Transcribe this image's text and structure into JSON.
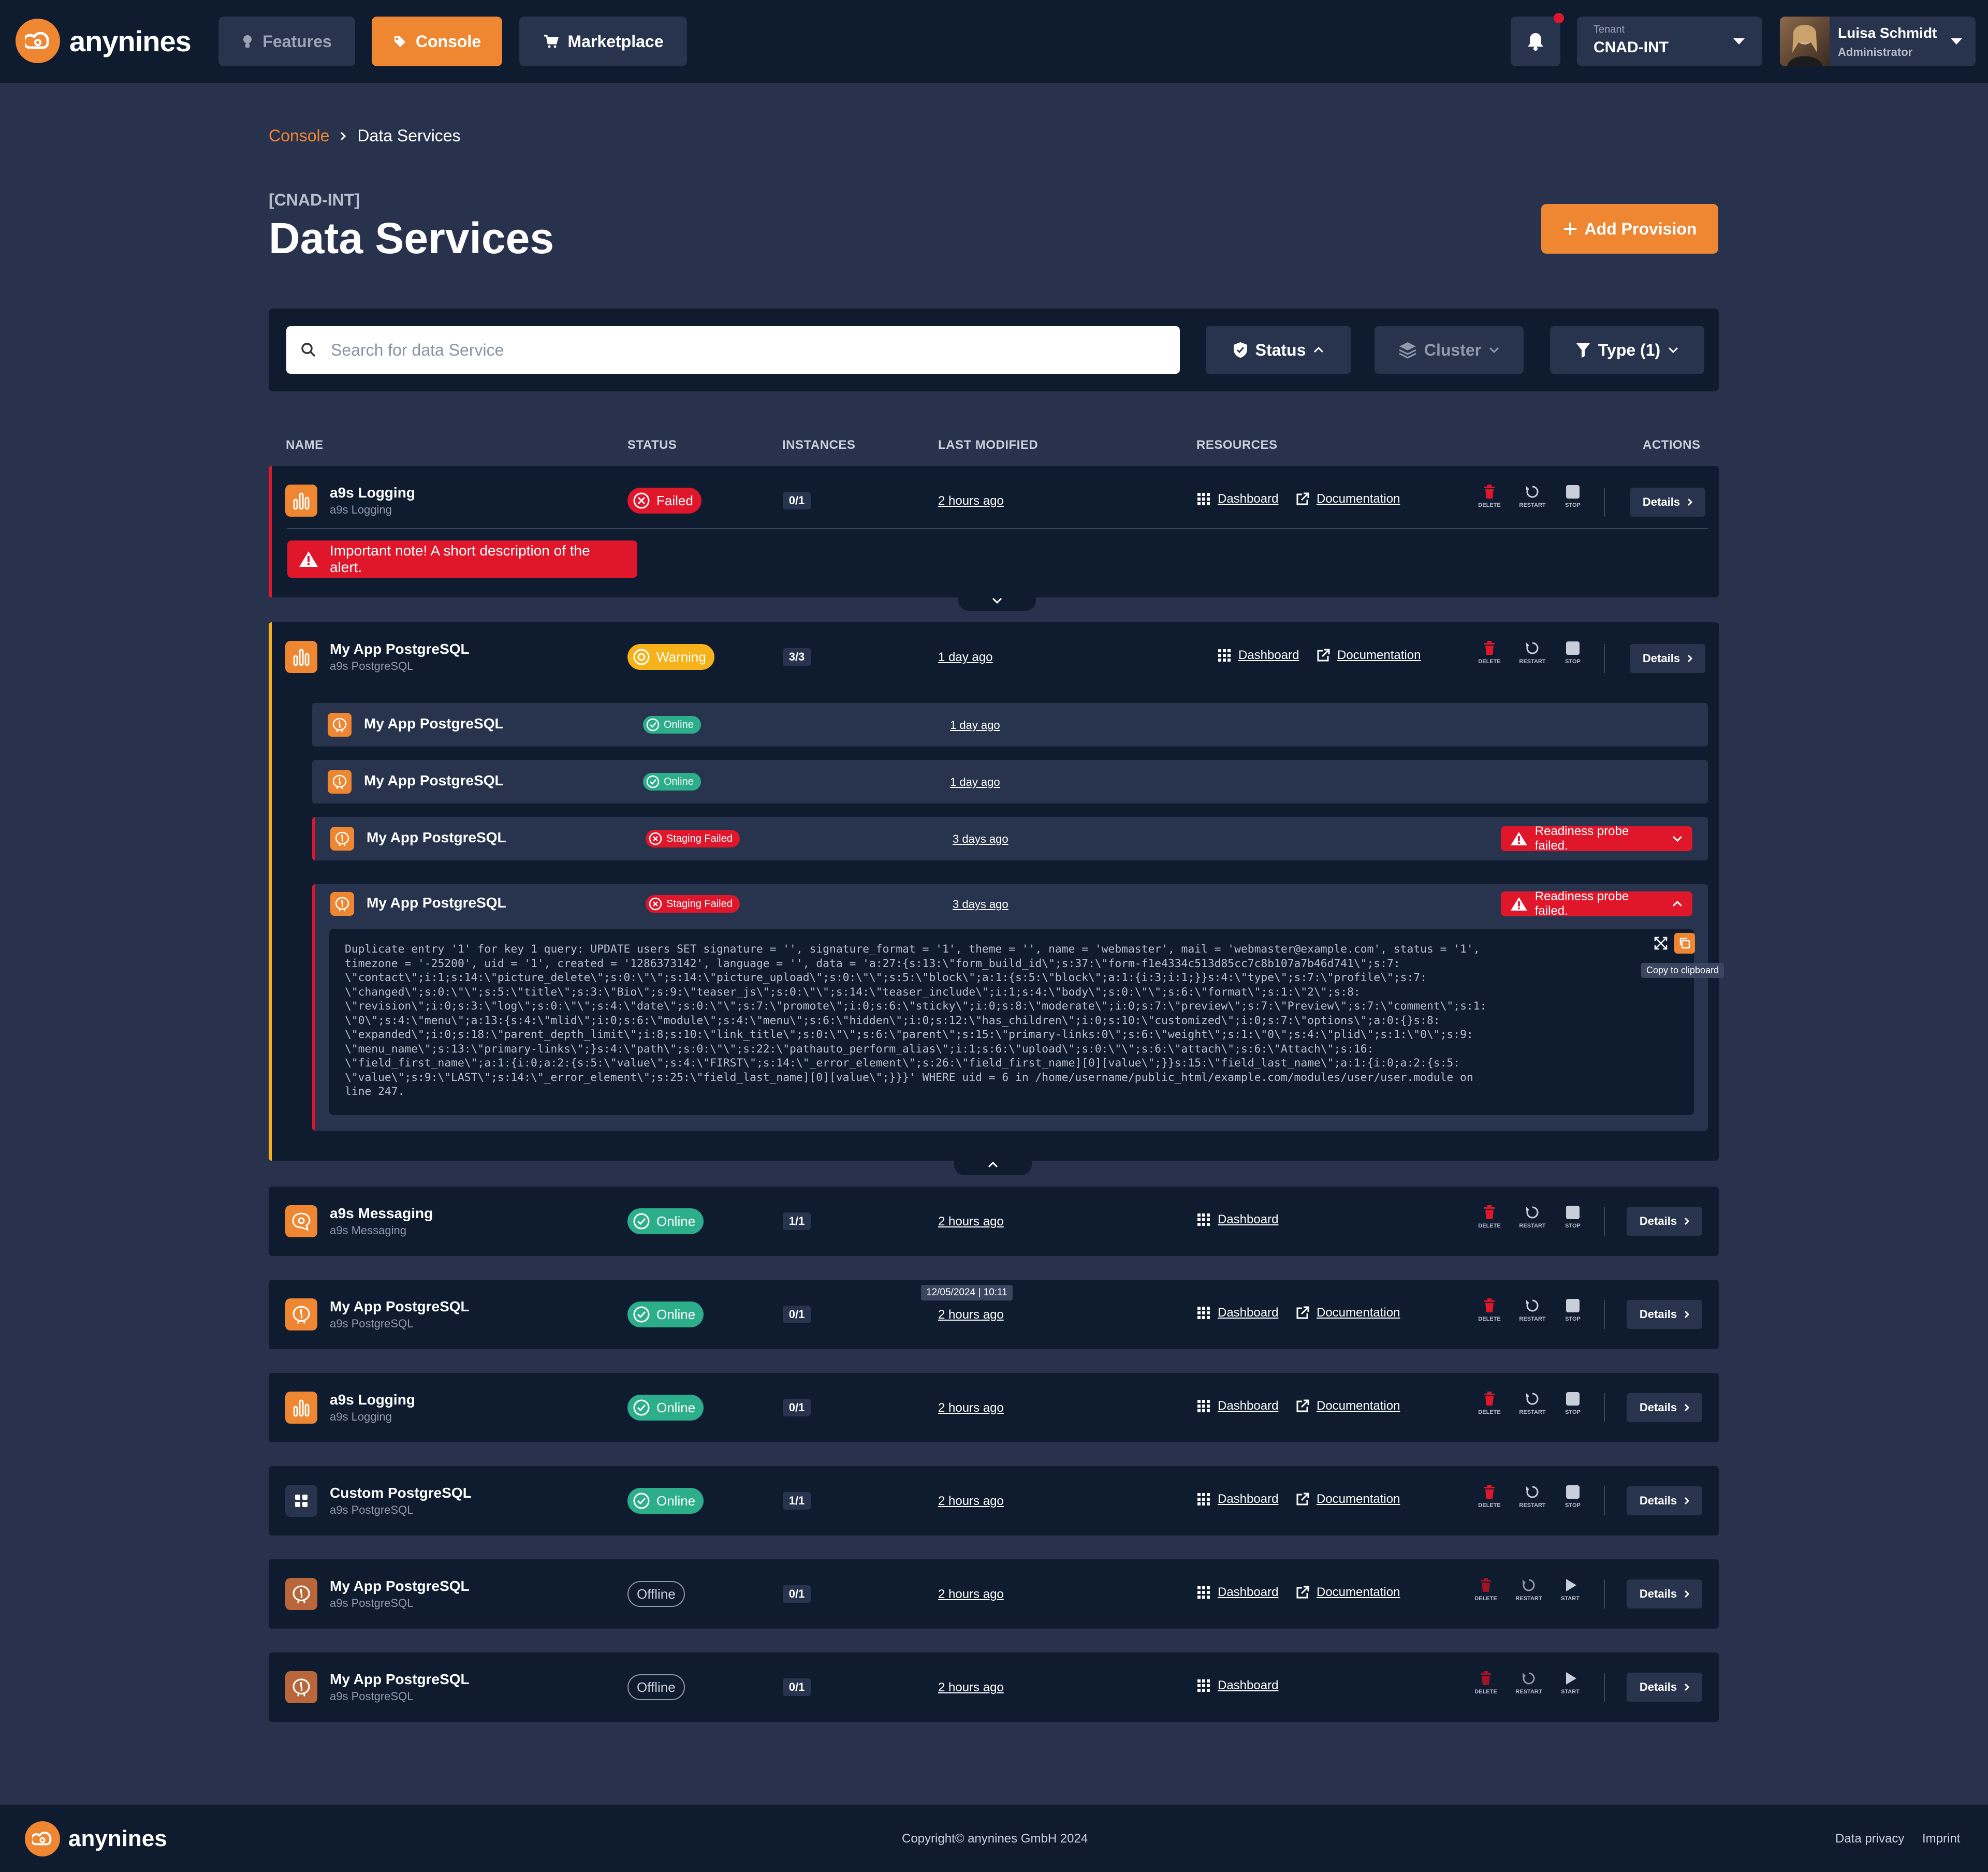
{
  "brand": "anynines",
  "nav": {
    "features": "Features",
    "console": "Console",
    "marketplace": "Marketplace"
  },
  "tenant": {
    "label": "Tenant",
    "value": "CNAD-INT"
  },
  "user": {
    "name": "Luisa Schmidt",
    "role": "Administrator"
  },
  "breadcrumb": {
    "root": "Console",
    "current": "Data Services"
  },
  "page": {
    "tenant_tag": "[CNAD-INT]",
    "title": "Data Services",
    "add_button": "Add Provision"
  },
  "filters": {
    "search_placeholder": "Search for data Service",
    "status": "Status",
    "cluster": "Cluster",
    "type": "Type (1)"
  },
  "columns": {
    "name": "NAME",
    "status": "STATUS",
    "instances": "INSTANCES",
    "last_modified": "LAST MODIFIED",
    "resources": "RESOURCES",
    "actions": "ACTIONS"
  },
  "labels": {
    "dashboard": "Dashboard",
    "documentation": "Documentation",
    "details": "Details",
    "delete": "DELETE",
    "restart": "RESTART",
    "stop": "STOP",
    "start": "START",
    "copy": "Copy to clipboard"
  },
  "rows": [
    {
      "name": "a9s Logging",
      "sub": "a9s Logging",
      "status": "Failed",
      "instances": "0/1",
      "modified": "2 hours ago",
      "alert": "Important note! A short description of the alert."
    },
    {
      "name": "My App PostgreSQL",
      "sub": "a9s PostgreSQL",
      "status": "Warning",
      "instances": "3/3",
      "modified": "1 day ago",
      "children": [
        {
          "name": "My App PostgreSQL",
          "status": "Online",
          "modified": "1 day ago"
        },
        {
          "name": "My App PostgreSQL",
          "status": "Online",
          "modified": "1 day ago"
        },
        {
          "name": "My App PostgreSQL",
          "status": "Staging Failed",
          "modified": "3 days ago",
          "probe": "Readiness probe failed."
        },
        {
          "name": "My App PostgreSQL",
          "status": "Staging Failed",
          "modified": "3 days ago",
          "probe": "Readiness probe failed.",
          "log": "Duplicate entry '1' for key 1 query: UPDATE users SET signature = '', signature_format = '1', theme = '', name = 'webmaster', mail = 'webmaster@example.com', status = '1',\ntimezone = '-25200', uid = '1', created = '1286373142', language = '', data = 'a:27:{s:13:\\\"form_build_id\\\";s:37:\\\"form-f1e4334c513d85cc7c8b107a7b46d741\\\";s:7:\n\\\"contact\\\";i:1;s:14:\\\"picture_delete\\\";s:0:\\\"\\\";s:14:\\\"picture_upload\\\";s:0:\\\"\\\";s:5:\\\"block\\\";a:1:{s:5:\\\"block\\\";a:1:{i:3;i:1;}}s:4:\\\"type\\\";s:7:\\\"profile\\\";s:7:\n\\\"changed\\\";s:0:\\\"\\\";s:5:\\\"title\\\";s:3:\\\"Bio\\\";s:9:\\\"teaser_js\\\";s:0:\\\"\\\";s:14:\\\"teaser_include\\\";i:1;s:4:\\\"body\\\";s:0:\\\"\\\";s:6:\\\"format\\\";s:1:\\\"2\\\";s:8:\n\\\"revision\\\";i:0;s:3:\\\"log\\\";s:0:\\\"\\\";s:4:\\\"date\\\";s:0:\\\"\\\";s:7:\\\"promote\\\";i:0;s:6:\\\"sticky\\\";i:0;s:8:\\\"moderate\\\";i:0;s:7:\\\"preview\\\";s:7:\\\"Preview\\\";s:7:\\\"comment\\\";s:1:\n\\\"0\\\";s:4:\\\"menu\\\";a:13:{s:4:\\\"mlid\\\";i:0;s:6:\\\"module\\\";s:4:\\\"menu\\\";s:6:\\\"hidden\\\";i:0;s:12:\\\"has_children\\\";i:0;s:10:\\\"customized\\\";i:0;s:7:\\\"options\\\";a:0:{}s:8:\n\\\"expanded\\\";i:0;s:18:\\\"parent_depth_limit\\\";i:8;s:10:\\\"link_title\\\";s:0:\\\"\\\";s:6:\\\"parent\\\";s:15:\\\"primary-links:0\\\";s:6:\\\"weight\\\";s:1:\\\"0\\\";s:4:\\\"plid\\\";s:1:\\\"0\\\";s:9:\n\\\"menu_name\\\";s:13:\\\"primary-links\\\";}s:4:\\\"path\\\";s:0:\\\"\\\";s:22:\\\"pathauto_perform_alias\\\";i:1;s:6:\\\"upload\\\";s:0:\\\"\\\";s:6:\\\"attach\\\";s:6:\\\"Attach\\\";s:16:\n\\\"field_first_name\\\";a:1:{i:0;a:2:{s:5:\\\"value\\\";s:4:\\\"FIRST\\\";s:14:\\\"_error_element\\\";s:26:\\\"field_first_name][0][value\\\";}}s:15:\\\"field_last_name\\\";a:1:{i:0;a:2:{s:5:\n\\\"value\\\";s:9:\\\"LAST\\\";s:14:\\\"_error_element\\\";s:25:\\\"field_last_name][0][value\\\";}}}' WHERE uid = 6 in /home/username/public_html/example.com/modules/user/user.module on\nline 247."
        }
      ]
    },
    {
      "name": "a9s Messaging",
      "sub": "a9s Messaging",
      "status": "Online",
      "instances": "1/1",
      "modified": "2 hours ago"
    },
    {
      "name": "My App PostgreSQL",
      "sub": "a9s PostgreSQL",
      "status": "Online",
      "instances": "0/1",
      "modified": "2 hours ago",
      "tooltip": "12/05/2024 | 10:11"
    },
    {
      "name": "a9s Logging",
      "sub": "a9s Logging",
      "status": "Online",
      "instances": "0/1",
      "modified": "2 hours ago"
    },
    {
      "name": "Custom PostgreSQL",
      "sub": "a9s PostgreSQL",
      "status": "Online",
      "instances": "1/1",
      "modified": "2 hours ago"
    },
    {
      "name": "My App PostgreSQL",
      "sub": "a9s PostgreSQL",
      "status": "Offline",
      "instances": "0/1",
      "modified": "2 hours ago"
    },
    {
      "name": "My App PostgreSQL",
      "sub": "a9s PostgreSQL",
      "status": "Offline",
      "instances": "0/1",
      "modified": "2 hours ago"
    }
  ],
  "footer": {
    "copyright": "Copyright© anynines GmbH 2024",
    "privacy": "Data privacy",
    "imprint": "Imprint"
  },
  "colors": {
    "bg": "#29324d",
    "panel": "#0f1c30",
    "accent": "#ee8632",
    "online": "#2cae8b",
    "failed": "#e0162b",
    "warning": "#f5b21b"
  }
}
